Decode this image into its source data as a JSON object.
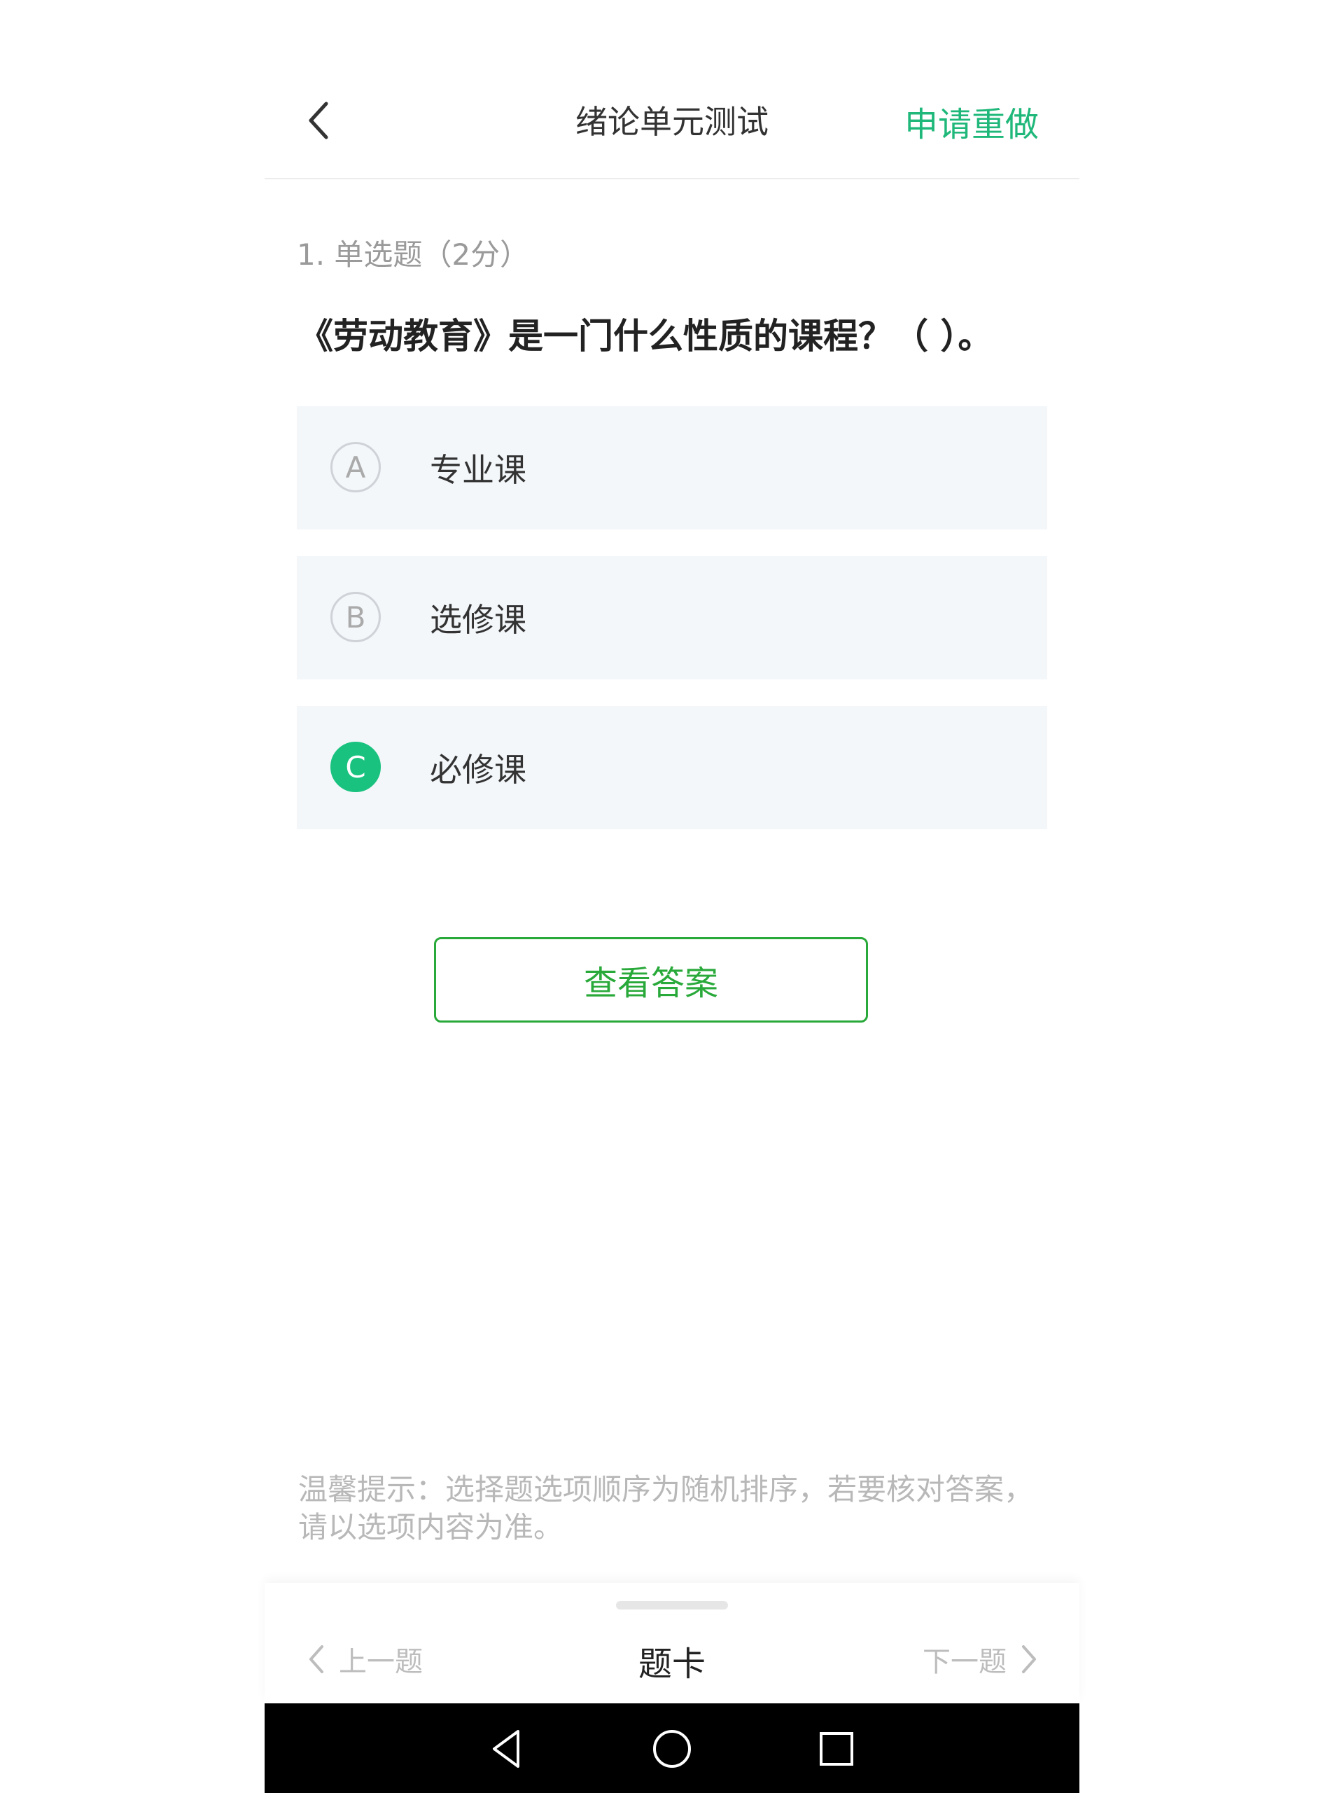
{
  "header": {
    "title": "绪论单元测试",
    "redo_label": "申请重做"
  },
  "question": {
    "type_label": "1. 单选题（2分）",
    "text": "《劳动教育》是一门什么性质的课程？（ ）。",
    "options": [
      {
        "letter": "A",
        "text": "专业课",
        "selected": false
      },
      {
        "letter": "B",
        "text": "选修课",
        "selected": false
      },
      {
        "letter": "C",
        "text": "必修课",
        "selected": true
      }
    ]
  },
  "answer_button_label": "查看答案",
  "tip": "温馨提示：选择题选项顺序为随机排序，若要核对答案，请以选项内容为准。",
  "bottom_nav": {
    "prev_label": "上一题",
    "card_label": "题卡",
    "next_label": "下一题"
  },
  "colors": {
    "accent": "#1fb87a",
    "selected": "#19c27e",
    "button": "#29a93a",
    "option_bg": "#f3f7fa"
  },
  "icons": {
    "back": "chevron-left-icon",
    "prev": "chevron-left-icon",
    "next": "chevron-right-icon",
    "sys_back": "triangle-back-icon",
    "sys_home": "circle-home-icon",
    "sys_recent": "square-recent-icon"
  }
}
